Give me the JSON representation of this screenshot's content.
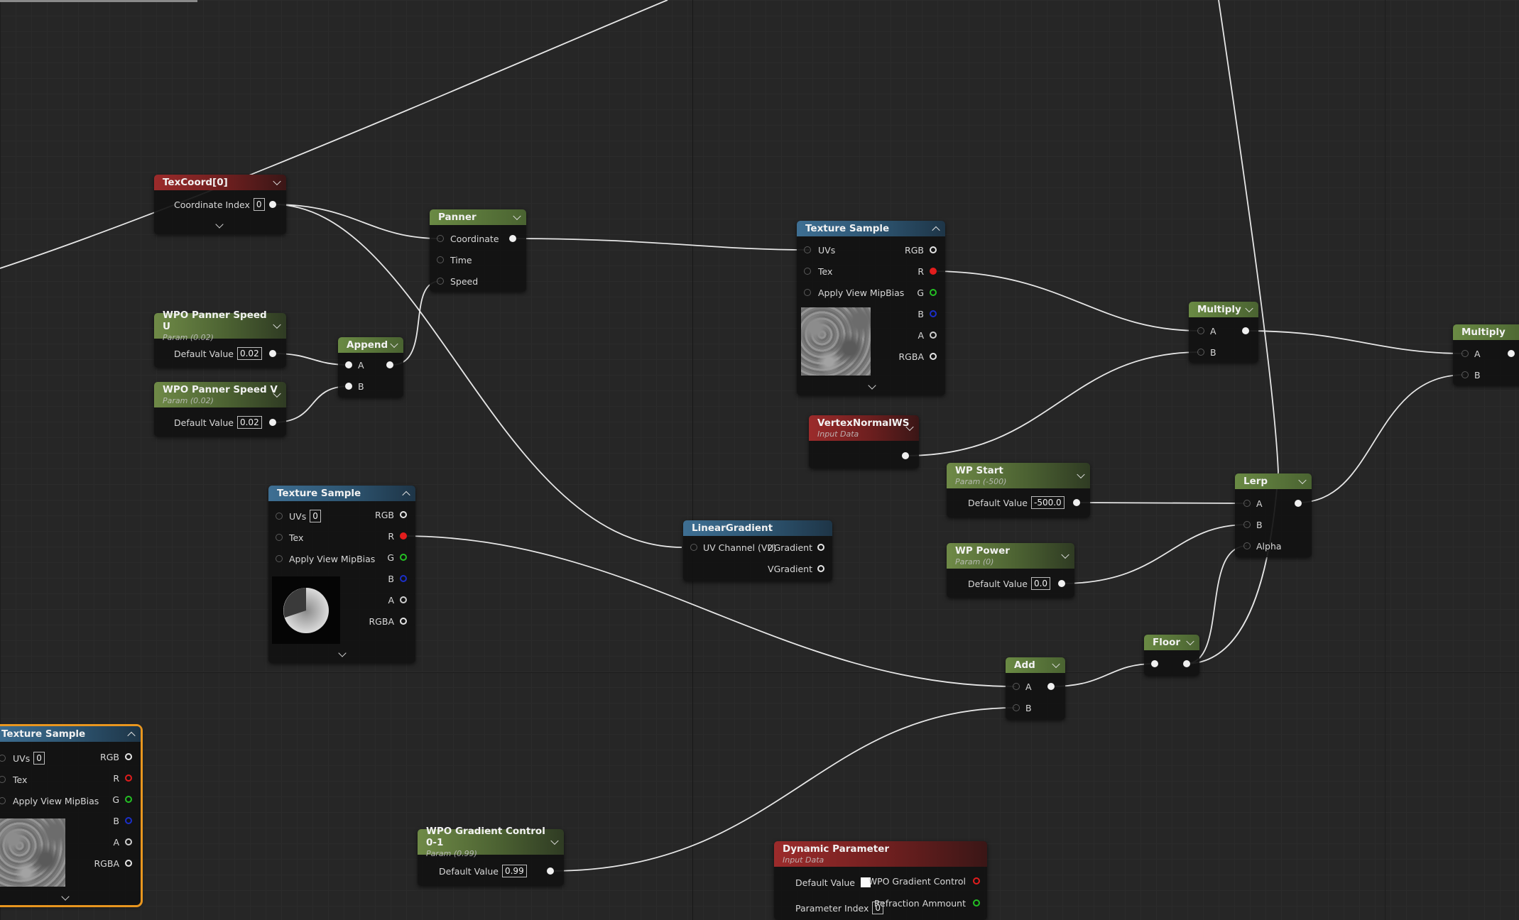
{
  "nodes": {
    "texcoord": {
      "title": "TexCoord[0]",
      "coord_label": "Coordinate Index",
      "coord_value": "0"
    },
    "panner": {
      "title": "Panner",
      "pins": [
        "Coordinate",
        "Time",
        "Speed"
      ]
    },
    "tex_sample_top": {
      "title": "Texture Sample",
      "in_pins": [
        "UVs",
        "Tex",
        "Apply View MipBias"
      ],
      "out_pins": [
        "RGB",
        "R",
        "G",
        "B",
        "A",
        "RGBA"
      ]
    },
    "speed_u": {
      "title": "WPO Panner Speed U",
      "subtitle": "Param (0.02)",
      "default_label": "Default Value",
      "default_value": "0.02"
    },
    "speed_v": {
      "title": "WPO Panner Speed V",
      "subtitle": "Param (0.02)",
      "default_label": "Default Value",
      "default_value": "0.02"
    },
    "append": {
      "title": "Append",
      "pins": [
        "A",
        "B"
      ]
    },
    "multiply1": {
      "title": "Multiply",
      "pins": [
        "A",
        "B"
      ]
    },
    "multiply2": {
      "title": "Multiply",
      "pins": [
        "A",
        "B"
      ]
    },
    "vertex_normal": {
      "title": "VertexNormalWS",
      "subtitle": "Input Data"
    },
    "wp_start": {
      "title": "WP Start",
      "subtitle": "Param (-500)",
      "default_label": "Default Value",
      "default_value": "-500.0"
    },
    "wp_power": {
      "title": "WP Power",
      "subtitle": "Param (0)",
      "default_label": "Default Value",
      "default_value": "0.0"
    },
    "lerp": {
      "title": "Lerp",
      "pins": [
        "A",
        "B",
        "Alpha"
      ]
    },
    "tex_sample_mid": {
      "title": "Texture Sample",
      "uvs_label": "UVs",
      "uvs_value": "0",
      "in_pins": [
        "Tex",
        "Apply View MipBias"
      ],
      "out_pins": [
        "RGB",
        "R",
        "G",
        "B",
        "A",
        "RGBA"
      ]
    },
    "linear_gradient": {
      "title": "LinearGradient",
      "in_pin": "UV Channel (V2)",
      "out_pins": [
        "UGradient",
        "VGradient"
      ]
    },
    "floor": {
      "title": "Floor"
    },
    "add": {
      "title": "Add",
      "pins": [
        "A",
        "B"
      ]
    },
    "tex_sample_sel": {
      "title": "Texture Sample",
      "uvs_label": "UVs",
      "uvs_value": "0",
      "in_pins": [
        "Tex",
        "Apply View MipBias"
      ],
      "out_pins": [
        "RGB",
        "R",
        "G",
        "B",
        "A",
        "RGBA"
      ]
    },
    "gradient_control": {
      "title": "WPO Gradient Control 0-1",
      "subtitle": "Param (0.99)",
      "default_label": "Default Value",
      "default_value": "0.99"
    },
    "dynamic_param": {
      "title": "Dynamic Parameter",
      "subtitle": "Input Data",
      "default_label": "Default Value",
      "index_label": "Parameter Index",
      "index_value": "0",
      "out_pins": [
        "WPO Gradient Control",
        "Refraction Ammount"
      ]
    }
  },
  "colors": {
    "selection": "#e8961f",
    "wire": "#e6e6e6",
    "param_header": "#5b7a3c",
    "input_header": "#8e2626",
    "texture_header": "#335f80"
  }
}
